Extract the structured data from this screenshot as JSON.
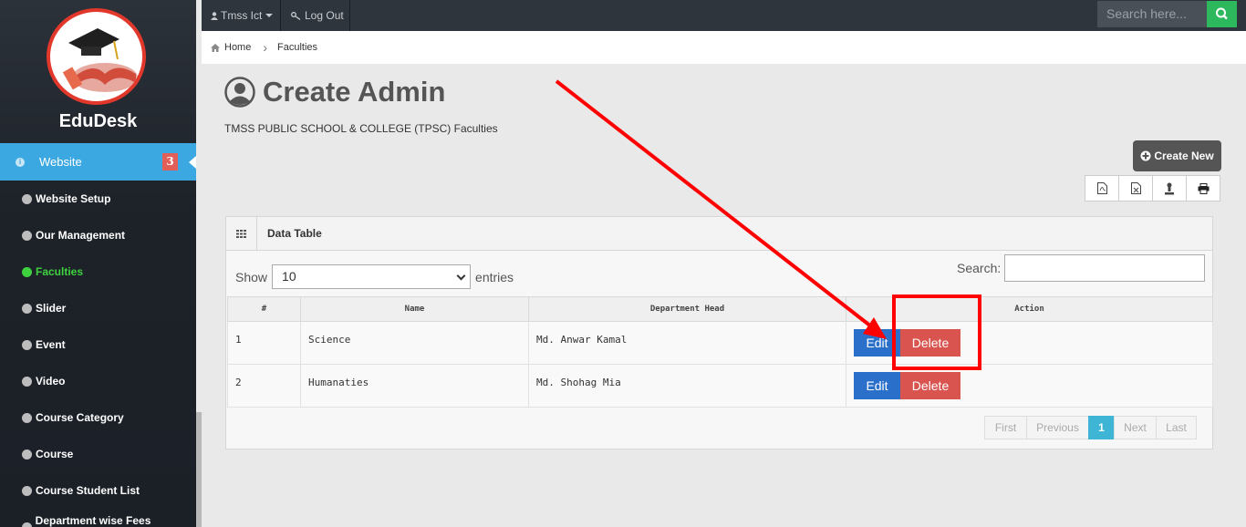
{
  "app": {
    "brand": "EduDesk"
  },
  "sidebar": {
    "active": {
      "label": "Website",
      "badge": "3"
    },
    "items": [
      {
        "label": "Website Setup"
      },
      {
        "label": "Our Management"
      },
      {
        "label": "Faculties"
      },
      {
        "label": "Slider"
      },
      {
        "label": "Event"
      },
      {
        "label": "Video"
      },
      {
        "label": "Course Category"
      },
      {
        "label": "Course"
      },
      {
        "label": "Course Student List"
      },
      {
        "label": "Department wise Fees structure"
      }
    ]
  },
  "topbar": {
    "user": "Tmss Ict",
    "logout": "Log Out",
    "search_placeholder": "Search here..."
  },
  "breadcrumb": {
    "home": "Home",
    "current": "Faculties"
  },
  "page": {
    "title": "Create Admin",
    "subtitle": "TMSS PUBLIC SCHOOL & COLLEGE (TPSC) Faculties",
    "create_button": "Create New"
  },
  "panel": {
    "title": "Data Table",
    "show_label": "Show",
    "entries_value": "10",
    "entries_label": "entries",
    "search_label": "Search:",
    "columns": [
      "#",
      "Name",
      "Department Head",
      "Action"
    ],
    "rows": [
      {
        "num": "1",
        "name": "Science",
        "head": "Md. Anwar Kamal",
        "edit": "Edit",
        "delete": "Delete"
      },
      {
        "num": "2",
        "name": "Humanaties",
        "head": "Md. Shohag Mia",
        "edit": "Edit",
        "delete": "Delete"
      }
    ],
    "pagination": {
      "first": "First",
      "previous": "Previous",
      "current": "1",
      "next": "Next",
      "last": "Last"
    }
  },
  "colors": {
    "accent": "#3ca8e1",
    "annotation": "#ff0000",
    "edit": "#2a6fc9",
    "delete": "#d9534f"
  }
}
